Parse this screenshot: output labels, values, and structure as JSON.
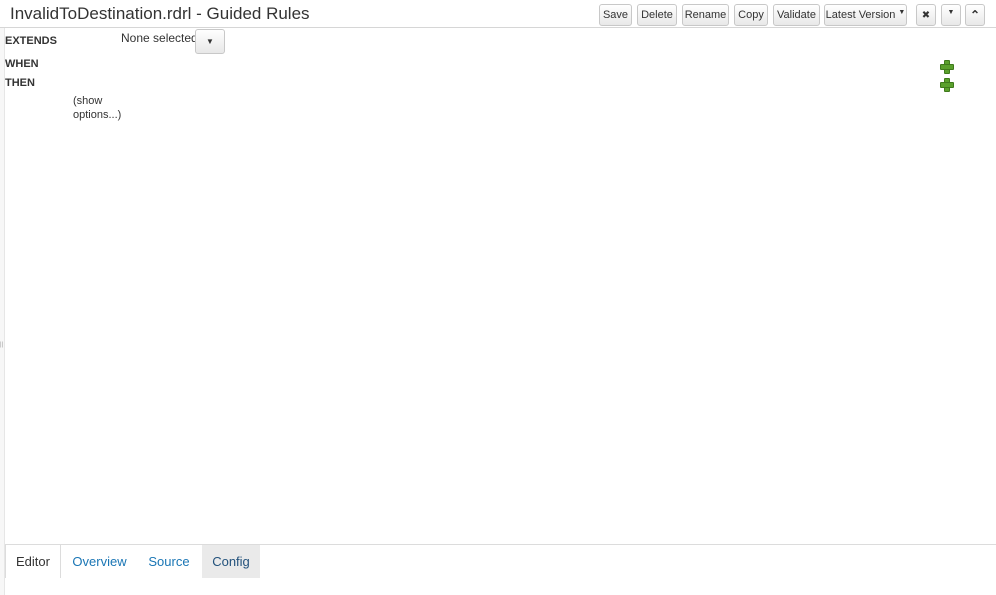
{
  "header": {
    "title": "InvalidToDestination.rdrl - Guided Rules",
    "buttons": {
      "save": "Save",
      "delete": "Delete",
      "rename": "Rename",
      "copy": "Copy",
      "validate": "Validate",
      "latest_version": "Latest Version"
    },
    "icons": {
      "close": "✖",
      "dropdown": "▾",
      "collapse": "⌃"
    }
  },
  "rule": {
    "extends_label": "EXTENDS",
    "extends_value": "None selected",
    "when_label": "WHEN",
    "then_label": "THEN",
    "show_options": "(show options...)"
  },
  "tabs": [
    "Editor",
    "Overview",
    "Source",
    "Config"
  ],
  "colors": {
    "link": "#1a76b5",
    "add_icon": "#5aa02c"
  }
}
